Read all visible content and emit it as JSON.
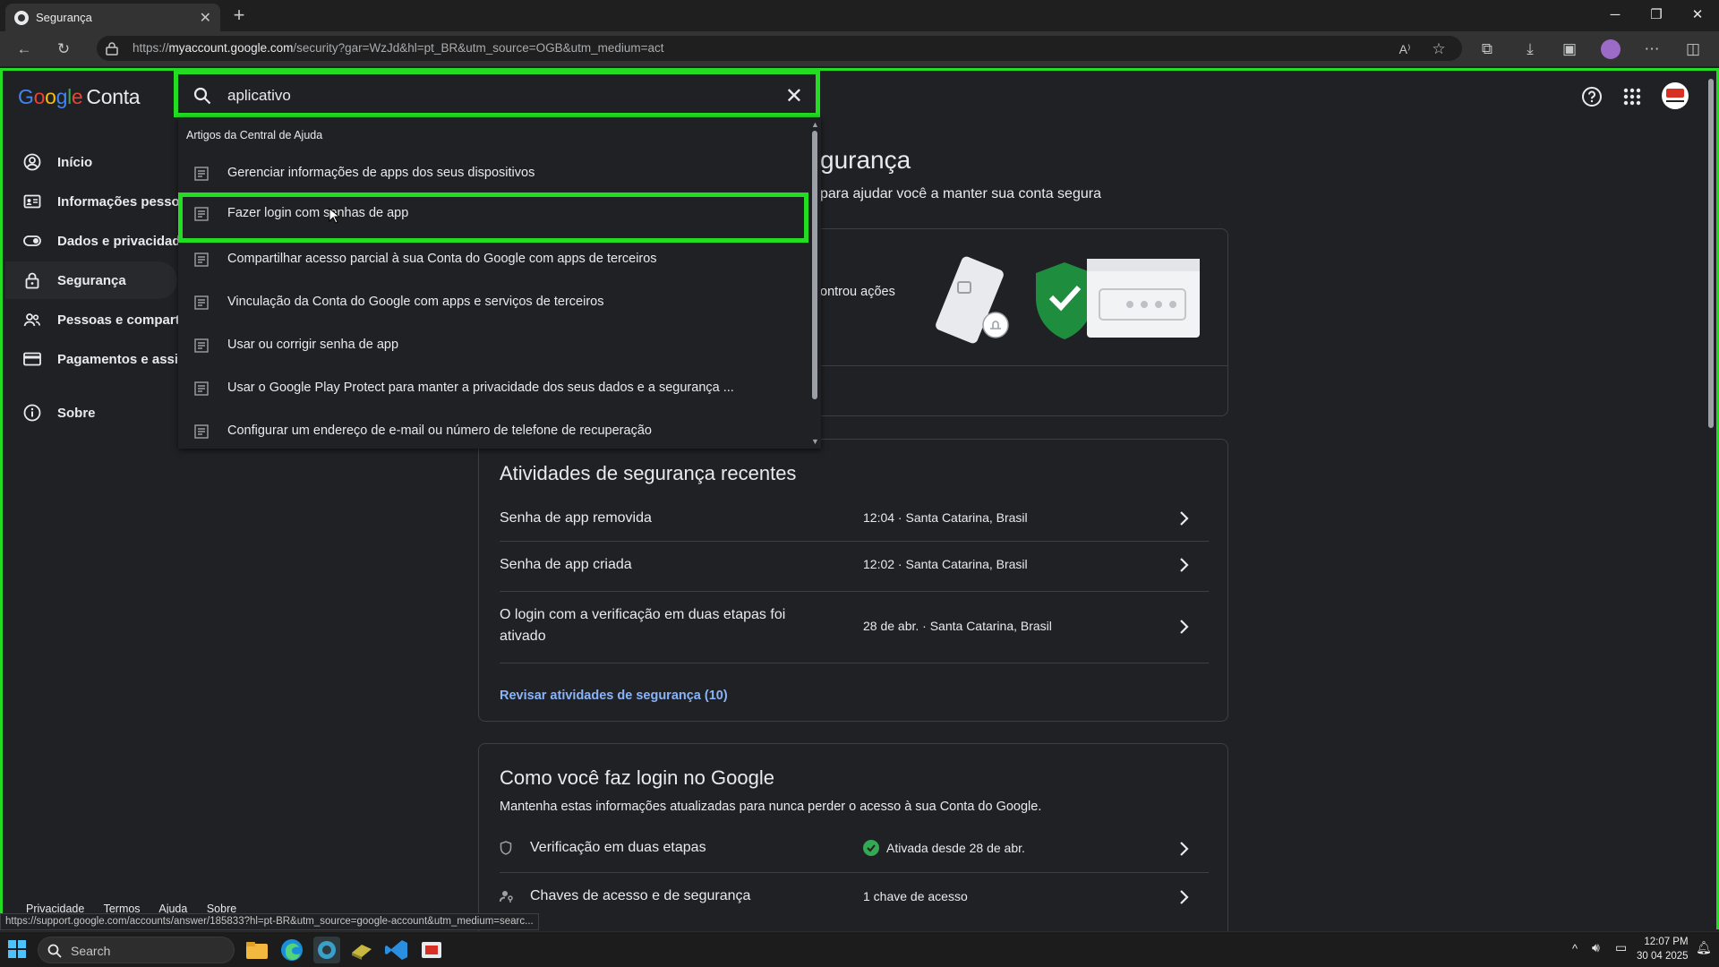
{
  "browser": {
    "tab_title": "Segurança",
    "url_prefix": "https://",
    "url_host": "myaccount.google.com",
    "url_path": "/security?gar=WzJd&hl=pt_BR&utm_source=OGB&utm_medium=act"
  },
  "header": {
    "logo_letters": [
      "G",
      "o",
      "o",
      "g",
      "l",
      "e"
    ],
    "product": "Conta"
  },
  "sidebar": {
    "items": [
      {
        "label": "Início",
        "icon": "account-circle-icon"
      },
      {
        "label": "Informações pessoais",
        "icon": "id-card-icon"
      },
      {
        "label": "Dados e privacidade",
        "icon": "toggle-icon"
      },
      {
        "label": "Segurança",
        "icon": "lock-icon"
      },
      {
        "label": "Pessoas e compartilhamento",
        "icon": "people-icon"
      },
      {
        "label": "Pagamentos e assinaturas",
        "icon": "credit-card-icon"
      },
      {
        "label": "Sobre",
        "icon": "info-icon"
      }
    ]
  },
  "search": {
    "query": "aplicativo",
    "section_header": "Artigos da Central de Ajuda",
    "results": [
      "Gerenciar informações de apps dos seus dispositivos",
      "Fazer login com senhas de app",
      "Compartilhar acesso parcial à sua Conta do Google com apps de terceiros",
      "Vinculação da Conta do Google com apps e serviços de terceiros",
      "Usar ou corrigir senha de app",
      "Usar o Google Play Protect para manter a privacidade dos seus dados e a segurança ...",
      "Configurar um endereço de e-mail ou número de telefone de recuperação"
    ]
  },
  "main": {
    "title_visible": "gurança",
    "subtitle_visible": "para ajudar você a manter sua conta segura",
    "card1_text_visible": "ontrou ações",
    "recent": {
      "title": "Atividades de segurança recentes",
      "rows": [
        {
          "label": "Senha de app removida",
          "meta": "12:04 · Santa Catarina, Brasil"
        },
        {
          "label": "Senha de app criada",
          "meta": "12:02 · Santa Catarina, Brasil"
        },
        {
          "label_line1": "O login com a verificação em duas etapas foi",
          "label_line2": "ativado",
          "meta": "28 de abr. · Santa Catarina, Brasil"
        }
      ],
      "link": "Revisar atividades de segurança (10)"
    },
    "signin": {
      "title": "Como você faz login no Google",
      "subtitle": "Mantenha estas informações atualizadas para nunca perder o acesso à sua Conta do Google.",
      "rows": [
        {
          "label": "Verificação em duas etapas",
          "meta": "Ativada desde 28 de abr."
        },
        {
          "label": "Chaves de acesso e de segurança",
          "meta": "1 chave de acesso"
        }
      ]
    }
  },
  "footer": {
    "links": [
      "Privacidade",
      "Termos",
      "Ajuda",
      "Sobre"
    ],
    "status_url": "https://support.google.com/accounts/answer/185833?hl=pt-BR&utm_source=google-account&utm_medium=searc..."
  },
  "taskbar": {
    "search_placeholder": "Search",
    "time": "12:07 PM",
    "date": "30 04 2025"
  },
  "colors": {
    "highlight": "#22dd22",
    "link": "#8ab4f8",
    "shield": "#1e8e3e"
  }
}
